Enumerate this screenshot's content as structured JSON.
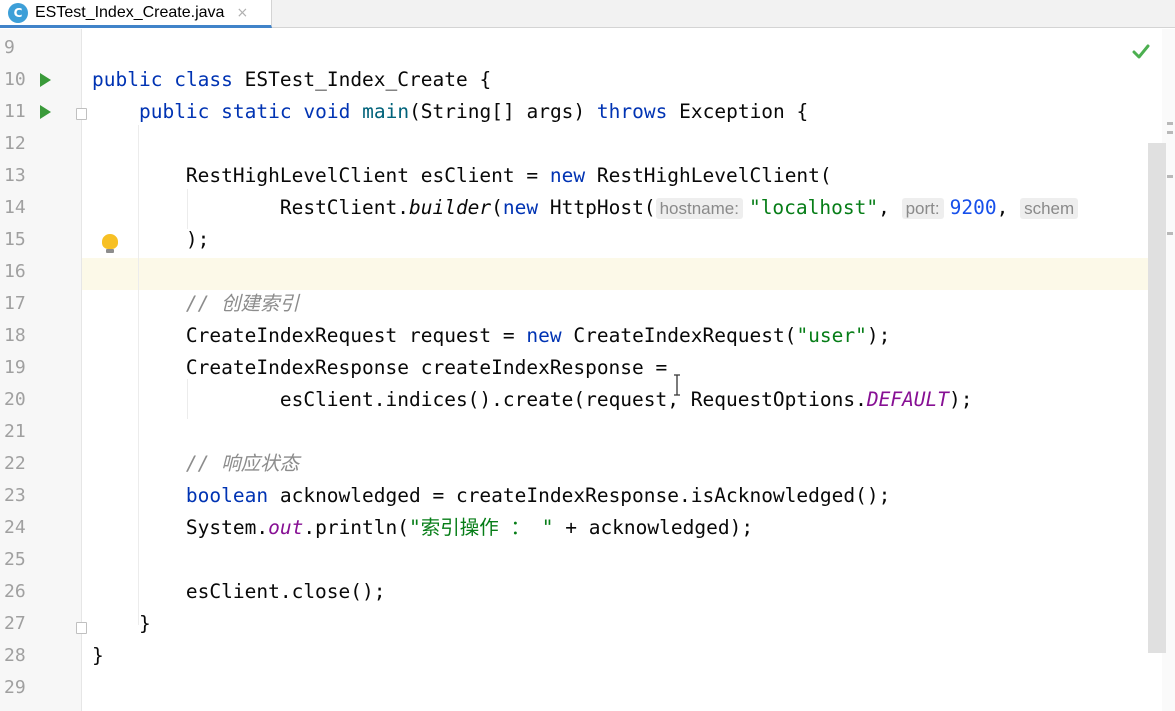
{
  "tab": {
    "file_name": "ESTest_Index_Create.java",
    "icon": "java-class-icon",
    "close": "×"
  },
  "lines": [
    {
      "num": "9"
    },
    {
      "num": "10"
    },
    {
      "num": "11"
    },
    {
      "num": "12"
    },
    {
      "num": "13"
    },
    {
      "num": "14"
    },
    {
      "num": "15"
    },
    {
      "num": "16"
    },
    {
      "num": "17"
    },
    {
      "num": "18"
    },
    {
      "num": "19"
    },
    {
      "num": "20"
    },
    {
      "num": "21"
    },
    {
      "num": "22"
    },
    {
      "num": "23"
    },
    {
      "num": "24"
    },
    {
      "num": "25"
    },
    {
      "num": "26"
    },
    {
      "num": "27"
    },
    {
      "num": "28"
    },
    {
      "num": "29"
    }
  ],
  "code": {
    "l10": {
      "kw1": "public",
      "kw2": "class",
      "name": "ESTest_Index_Create",
      "brace": "{"
    },
    "l11": {
      "kw1": "public",
      "kw2": "static",
      "kw3": "void",
      "method": "main",
      "params": "(String[] args)",
      "kw4": "throws",
      "exc": "Exception {"
    },
    "l13": {
      "decl": "RestHighLevelClient esClient = ",
      "kw": "new",
      "rest": " RestHighLevelClient("
    },
    "l14": {
      "pre": "RestClient.",
      "builder": "builder",
      "open": "(",
      "kw": "new",
      "host": " HttpHost(",
      "hint1": "hostname:",
      "str": "\"localhost\"",
      "comma1": ",",
      "hint2": "port:",
      "port": "9200",
      "comma2": ",",
      "hint3": "schem"
    },
    "l15": {
      "text": ");"
    },
    "l17": {
      "comment": "// 创建索引"
    },
    "l18": {
      "decl": "CreateIndexRequest request = ",
      "kw": "new",
      "ctor": " CreateIndexRequest(",
      "str": "\"user\"",
      "end": ");"
    },
    "l19": {
      "text": "CreateIndexResponse createIndexResponse = "
    },
    "l20": {
      "pre": "esClient.indices().create(request, RequestOptions.",
      "constant": "DEFAULT",
      "end": ");"
    },
    "l22": {
      "comment": "// 响应状态"
    },
    "l23": {
      "kw": "boolean",
      "rest": " acknowledged = createIndexResponse.isAcknowledged();"
    },
    "l24": {
      "pre": "System.",
      "field": "out",
      "call": ".println(",
      "str": "\"索引操作 ： \"",
      "rest": " + acknowledged);"
    },
    "l26": {
      "text": "esClient.close();"
    },
    "l27": {
      "text": "}"
    },
    "l28": {
      "text": "}"
    }
  },
  "colors": {
    "keyword": "#0033b3",
    "string": "#067d17",
    "comment": "#8c8c8c",
    "static_field": "#871094",
    "number": "#1750eb",
    "current_line": "#fcf9e8",
    "run_icon": "#3a9a3a",
    "check": "#4caf50"
  },
  "gutter_icons": {
    "run": "run-arrow-icon",
    "fold": "fold-icon",
    "bulb": "lightbulb-icon"
  },
  "status": {
    "inspection": "check-icon"
  }
}
